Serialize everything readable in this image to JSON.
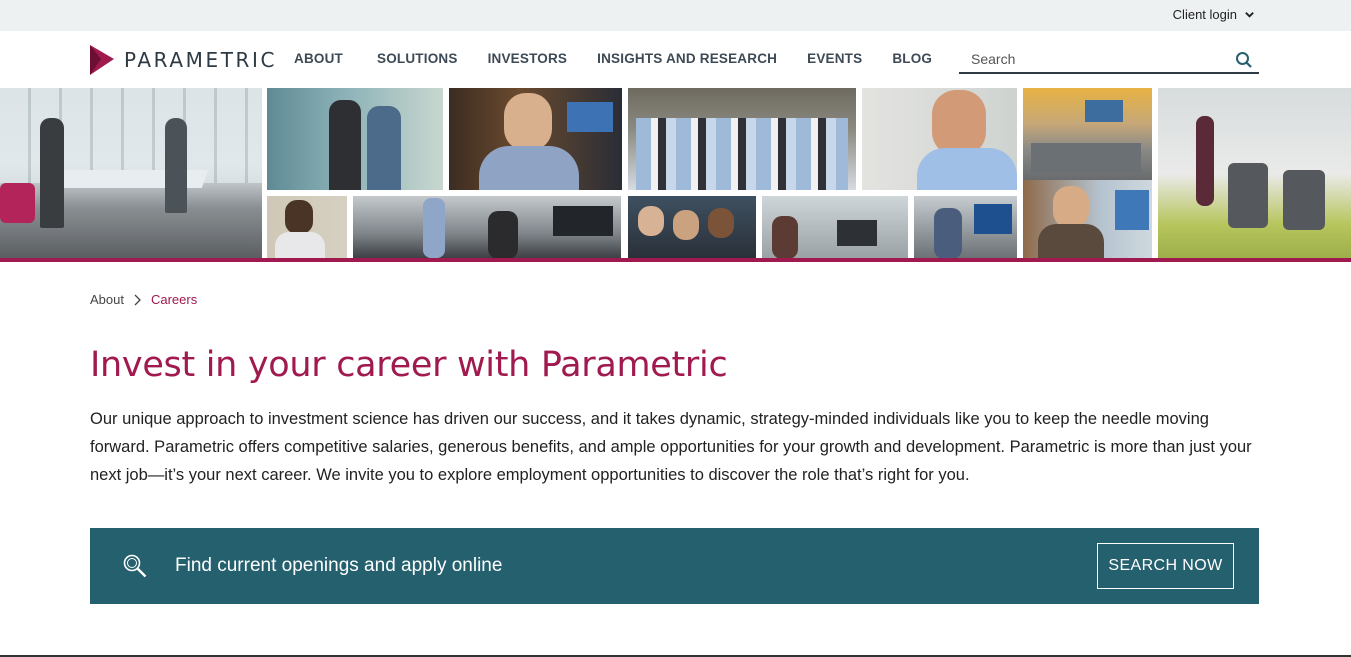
{
  "utility": {
    "client_login": "Client login"
  },
  "header": {
    "logo_text": "PARAMETRIC",
    "nav": [
      "ABOUT",
      "SOLUTIONS",
      "INVESTORS",
      "INSIGHTS AND RESEARCH",
      "EVENTS",
      "BLOG"
    ],
    "search_placeholder": "Search"
  },
  "breadcrumb": {
    "parent": "About",
    "current": "Careers"
  },
  "main": {
    "headline": "Invest in your career with Parametric",
    "intro": "Our unique approach to investment science has driven our success, and it takes dynamic, strategy-minded individuals like you to keep the needle moving forward. Parametric offers competitive salaries, generous benefits, and ample opportunities for your growth and development. Parametric is more than just your next job—it’s your next career. We invite you to explore employment opportunities to discover the role that’s right for you."
  },
  "cta": {
    "text": "Find current openings and apply online",
    "button": "SEARCH NOW"
  },
  "colors": {
    "brand": "#a01a4f",
    "cta_band": "#25606e",
    "utility_bar": "#eef1f2",
    "nav_text": "#3d4a55"
  },
  "icons": [
    "chevron-down-icon",
    "parametric-logo-icon",
    "search-icon",
    "breadcrumb-chevron-icon",
    "magnifier-icon"
  ]
}
